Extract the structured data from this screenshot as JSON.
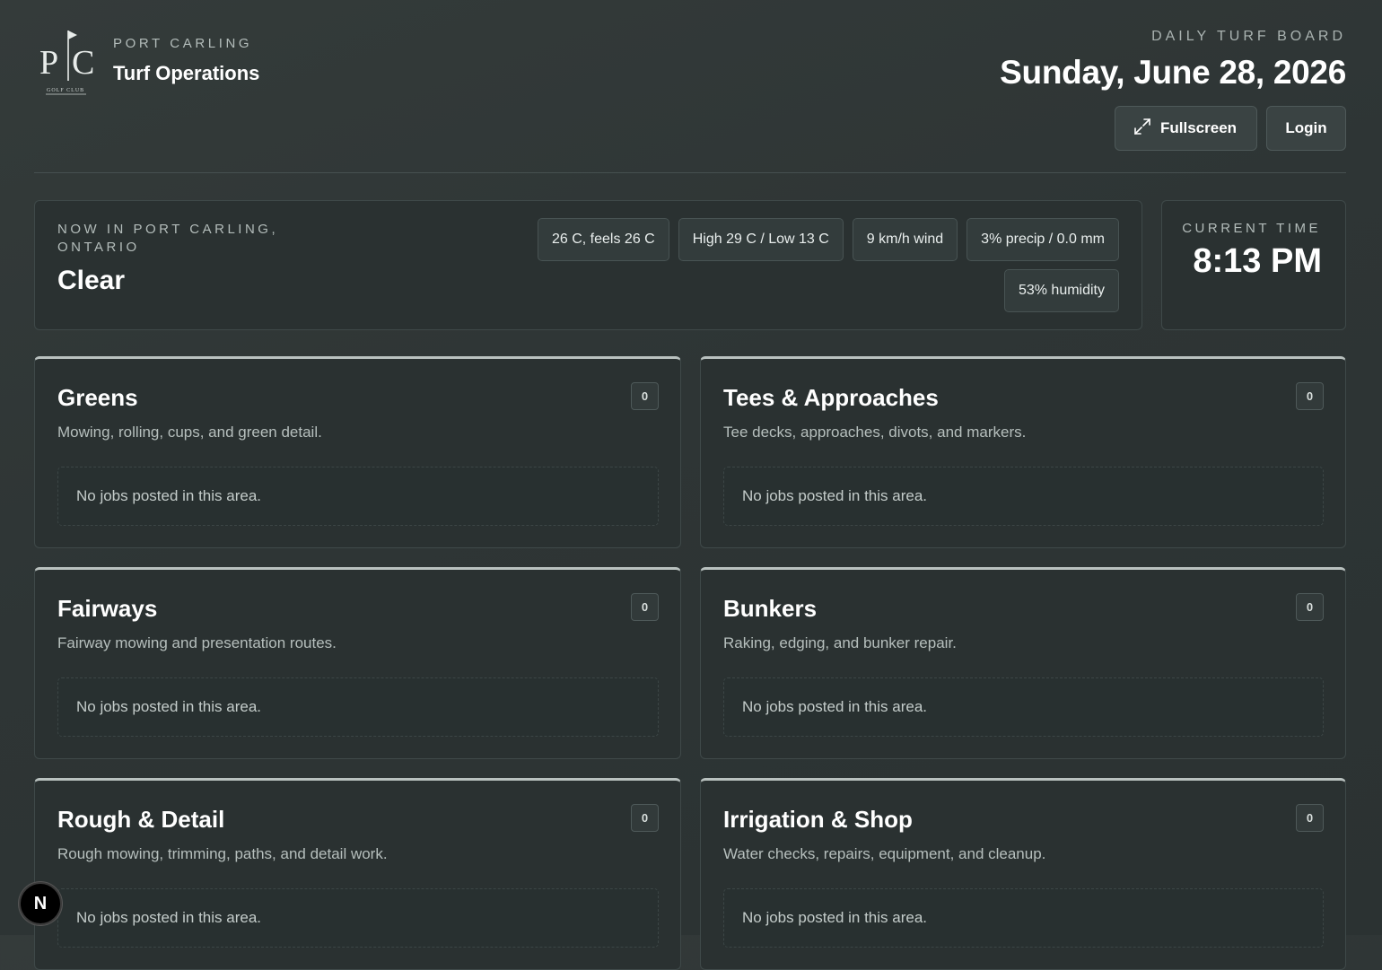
{
  "header": {
    "club": "PORT CARLING",
    "app_title": "Turf Operations",
    "board_kicker": "DAILY TURF BOARD",
    "date": "Sunday, June 28, 2026",
    "logo_text": "PC",
    "logo_subtext": "GOLF CLUB",
    "fullscreen_label": "Fullscreen",
    "fullscreen_icon": "expand-icon",
    "login_label": "Login"
  },
  "weather": {
    "location": "NOW IN PORT CARLING, ONTARIO",
    "condition": "Clear",
    "chips": [
      "26 C, feels 26 C",
      "High 29 C / Low 13 C",
      "9 km/h wind",
      "3% precip / 0.0 mm",
      "53% humidity"
    ]
  },
  "clock": {
    "label": "CURRENT TIME",
    "time": "8:13 PM"
  },
  "areas": [
    {
      "title": "Greens",
      "description": "Mowing, rolling, cups, and green detail.",
      "count": "0",
      "empty": "No jobs posted in this area."
    },
    {
      "title": "Tees & Approaches",
      "description": "Tee decks, approaches, divots, and markers.",
      "count": "0",
      "empty": "No jobs posted in this area."
    },
    {
      "title": "Fairways",
      "description": "Fairway mowing and presentation routes.",
      "count": "0",
      "empty": "No jobs posted in this area."
    },
    {
      "title": "Bunkers",
      "description": "Raking, edging, and bunker repair.",
      "count": "0",
      "empty": "No jobs posted in this area."
    },
    {
      "title": "Rough & Detail",
      "description": "Rough mowing, trimming, paths, and detail work.",
      "count": "0",
      "empty": "No jobs posted in this area."
    },
    {
      "title": "Irrigation & Shop",
      "description": "Water checks, repairs, equipment, and cleanup.",
      "count": "0",
      "empty": "No jobs posted in this area."
    }
  ],
  "dev_badge": "N",
  "colors": {
    "background": "#2e3535",
    "card": "#2a3131",
    "accent_border": "#b9c1bf",
    "text_muted": "#b3bcba"
  }
}
